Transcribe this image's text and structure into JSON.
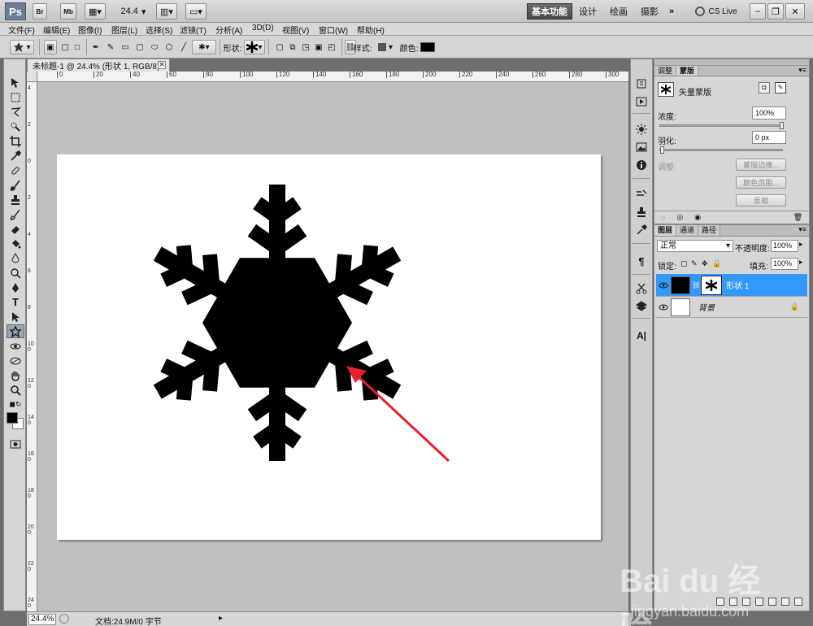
{
  "app": {
    "logo": "Ps",
    "zoom_value": "24.4",
    "workspace": {
      "essentials": "基本功能",
      "design": "设计",
      "painting": "绘画",
      "photography": "摄影",
      "more": "»",
      "cslive": "CS Live"
    }
  },
  "menu": [
    "文件(F)",
    "编辑(E)",
    "图像(I)",
    "图层(L)",
    "选择(S)",
    "滤镜(T)",
    "分析(A)",
    "3D(D)",
    "视图(V)",
    "窗口(W)",
    "帮助(H)"
  ],
  "options": {
    "shape_label": "形状:",
    "style_label": "样式:",
    "color_label": "颜色:",
    "color_swatch": "#000000"
  },
  "document": {
    "tab_title": "未标题-1 @ 24.4% (形状 1, RGB/8) *",
    "ruler_top": [
      "0",
      "20",
      "40",
      "60",
      "80",
      "100",
      "120",
      "140",
      "160",
      "180",
      "200",
      "220",
      "240",
      "260",
      "280",
      "300"
    ],
    "ruler_left": [
      "4",
      "2",
      "0",
      "2",
      "4",
      "6",
      "8",
      "100",
      "120",
      "140",
      "160",
      "180",
      "200",
      "220",
      "240"
    ]
  },
  "status": {
    "zoom": "24.4%",
    "doc_info": "文档:24.9M/0 字节"
  },
  "masks_panel": {
    "tabs": [
      "调整",
      "蒙版"
    ],
    "title": "矢量蒙版",
    "density_label": "浓度:",
    "density_value": "100%",
    "density_level": 1.0,
    "feather_label": "羽化:",
    "feather_value": "0 px",
    "feather_level": 0.0,
    "refine_label": "调整:",
    "btn_mask_edge": "蒙版边缘...",
    "btn_color_range": "颜色范围...",
    "btn_invert": "反相"
  },
  "layers_panel": {
    "tabs": [
      "图层",
      "通道",
      "路径"
    ],
    "blend_mode": "正常",
    "opacity_label": "不透明度:",
    "opacity_value": "100%",
    "lock_label": "锁定:",
    "fill_label": "填充:",
    "fill_value": "100%",
    "layers": [
      {
        "name": "形状 1",
        "selected": true
      },
      {
        "name": "背景",
        "selected": false
      }
    ]
  },
  "watermark": {
    "brand": "Bai du 经验",
    "url": "jingyan.baidu.com"
  },
  "colors": {
    "accent": "#3399ff",
    "arrow": "#e8202a",
    "foreground": "#000000",
    "background": "#ffffff"
  }
}
